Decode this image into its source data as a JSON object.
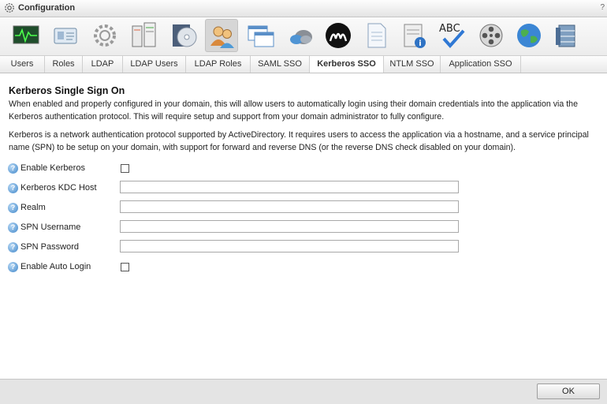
{
  "window": {
    "title": "Configuration",
    "help": "?"
  },
  "toolbar": {
    "icons": [
      "monitor-icon",
      "id-card-icon",
      "gear-icon",
      "server-icon",
      "disc-icon",
      "users-icon",
      "windows-icon",
      "cloud-icon",
      "logo-m-icon",
      "document-icon",
      "info-doc-icon",
      "spellcheck-icon",
      "film-reel-icon",
      "globe-icon",
      "database-icon"
    ],
    "active_index": 5
  },
  "tabs": [
    {
      "label": "Users"
    },
    {
      "label": "Roles"
    },
    {
      "label": "LDAP"
    },
    {
      "label": "LDAP Users"
    },
    {
      "label": "LDAP Roles"
    },
    {
      "label": "SAML SSO"
    },
    {
      "label": "Kerberos SSO",
      "active": true
    },
    {
      "label": "NTLM SSO"
    },
    {
      "label": "Application SSO"
    }
  ],
  "section": {
    "title": "Kerberos Single Sign On",
    "para1_line1": "When enabled and properly configured in your domain, this will allow users to automatically login using their domain credentials into the application via the",
    "para1_line2": "Kerberos authentication protocol. This will require setup and support from your domain administrator to fully configure.",
    "para2_line1": "Kerberos is a network authentication protocol supported by ActiveDirectory. It requires users to access the application via a hostname, and a service principal",
    "para2_line2": "name (SPN) to be setup on your domain, with support for forward and reverse DNS (or the reverse DNS check disabled on your domain)."
  },
  "form": {
    "enable_kerberos": {
      "label": "Enable Kerberos",
      "checked": false
    },
    "kdc_host": {
      "label": "Kerberos KDC Host",
      "value": ""
    },
    "realm": {
      "label": "Realm",
      "value": ""
    },
    "spn_username": {
      "label": "SPN Username",
      "value": ""
    },
    "spn_password": {
      "label": "SPN Password",
      "value": ""
    },
    "enable_auto_login": {
      "label": "Enable Auto Login",
      "checked": false
    }
  },
  "footer": {
    "ok_label": "OK"
  }
}
